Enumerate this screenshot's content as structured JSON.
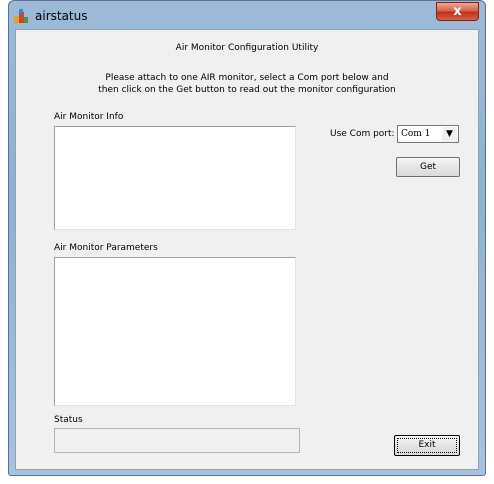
{
  "page_text": "y",
  "window": {
    "title": "airstatus",
    "close_glyph": "x"
  },
  "header": {
    "title": "Air Monitor Configuration Utility",
    "instruction_line1": "Please attach to one AIR monitor, select a Com port below and",
    "instruction_line2": "then click on the Get button to read out the monitor configuration"
  },
  "info": {
    "label": "Air Monitor Info"
  },
  "params": {
    "label": "Air Monitor Parameters"
  },
  "com": {
    "label": "Use Com port:",
    "selected": "Com 1",
    "arrow": "▼"
  },
  "buttons": {
    "get": "Get",
    "exit": "Exit"
  },
  "status": {
    "label": "Status"
  },
  "colors": {
    "window_frame": "#9dbbd8",
    "client": "#f0f0f0",
    "close": "#c0321a"
  }
}
